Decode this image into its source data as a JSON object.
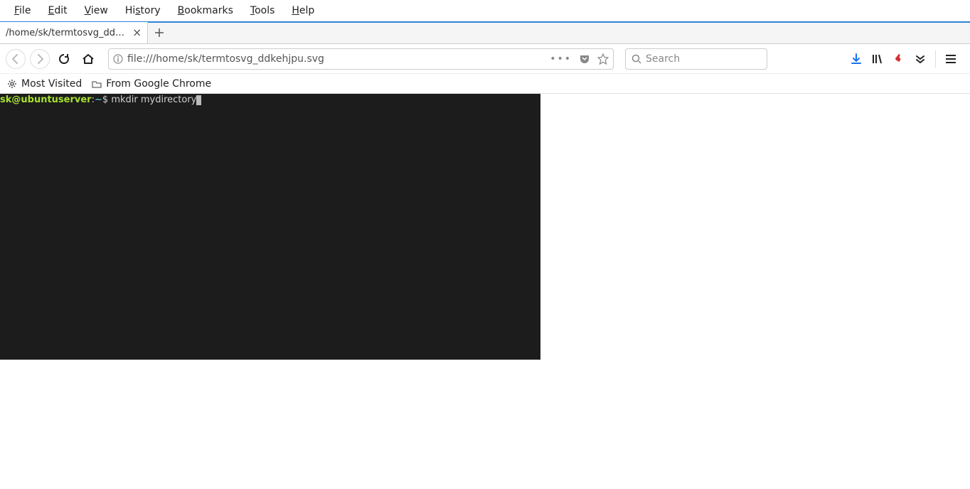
{
  "menubar": {
    "items": [
      {
        "label": "File",
        "ul": "F",
        "rest": "ile"
      },
      {
        "label": "Edit",
        "ul": "E",
        "rest": "dit"
      },
      {
        "label": "View",
        "ul": "V",
        "rest": "iew"
      },
      {
        "label": "History",
        "ul": "Hi",
        "rest": "story",
        "ulPrefix": "Hi",
        "plain": "History"
      },
      {
        "label": "Bookmarks",
        "ul": "B",
        "rest": "ookmarks"
      },
      {
        "label": "Tools",
        "ul": "T",
        "rest": "ools"
      },
      {
        "label": "Help",
        "ul": "H",
        "rest": "elp"
      }
    ],
    "history_ul": "s",
    "history_pre": "Hi",
    "history_post": "tory"
  },
  "tab": {
    "title": "/home/sk/termtosvg_ddkehjp"
  },
  "urlbar": {
    "url": "file:///home/sk/termtosvg_ddkehjpu.svg"
  },
  "searchbar": {
    "placeholder": "Search"
  },
  "bookmarks": {
    "most_visited": "Most Visited",
    "from_chrome": "From Google Chrome"
  },
  "terminal": {
    "user": "sk@ubuntuserver",
    "path": "~",
    "prompt": "$",
    "command": "mkdir mydirectory"
  }
}
